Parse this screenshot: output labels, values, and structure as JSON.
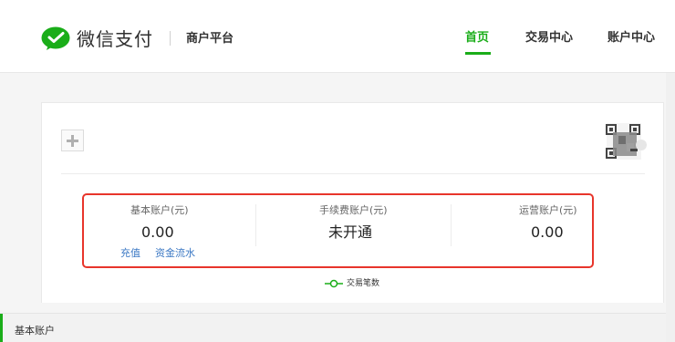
{
  "header": {
    "brand": "微信支付",
    "platform": "商户平台",
    "logo_icon": "wechat-pay-logo-icon",
    "nav": [
      {
        "label": "首页",
        "active": true
      },
      {
        "label": "交易中心",
        "active": false
      },
      {
        "label": "账户中心",
        "active": false
      }
    ]
  },
  "card": {
    "add_icon": "plus-icon",
    "avatar_icon": "qr-avatar-icon"
  },
  "accounts": {
    "basic": {
      "label": "基本账户(元)",
      "value": "0.00",
      "links": [
        "充值",
        "资金流水"
      ]
    },
    "fee": {
      "label": "手续费账户(元)",
      "value": "未开通"
    },
    "ops": {
      "label": "运营账户(元)",
      "value": "0.00"
    }
  },
  "chart_legend": {
    "label": "交易笔数"
  },
  "sub_tab": {
    "label": "基本账户"
  },
  "colors": {
    "accent": "#1aad19",
    "highlight_border": "#e8352b",
    "link": "#3b78c4"
  }
}
